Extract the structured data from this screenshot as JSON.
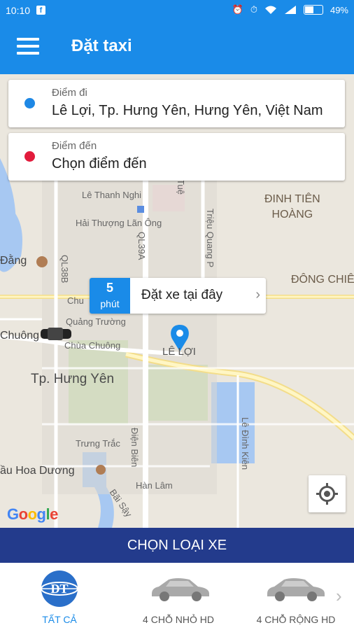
{
  "status_bar": {
    "time": "10:10",
    "fb": "f",
    "battery": "49%"
  },
  "app_bar": {
    "title": "Đặt taxi"
  },
  "origin": {
    "caption": "Điểm đi",
    "value": "Lê Lợi, Tp. Hưng Yên, Hưng Yên, Việt Nam",
    "color": "#1e88e5"
  },
  "destination": {
    "caption": "Điểm đến",
    "value": "Chọn điểm đến",
    "color": "#e21b3c"
  },
  "pickup": {
    "eta_value": "5",
    "eta_unit": "phút",
    "label": "Đặt xe tại đây"
  },
  "map": {
    "labels": {
      "le_thanh_nghi": "Lê Thanh Nghi",
      "dinh_tien_hoang": "ĐINH TIÊN\nHOÀNG",
      "hai_thuong_lan_ong": "Hải Thượng Lãn Ông",
      "dang": "Đằng",
      "ql39a": "QL39A",
      "ql38b": "QL38B",
      "dong_chieu": "ĐÔNG CHIÊ",
      "chu": "Chu",
      "quang_truong": "Quảng Trường",
      "chuong": "Chuông",
      "chua_chuong": "Chùa Chuông",
      "le_loi": "LÊ LỢI",
      "tp_hung_yen": "Tp. Hưng Yên",
      "trung_trac": "Trưng Trắc",
      "dien_bien": "Điện Biên",
      "le_dinh_kien": "Lê Đình Kiên",
      "hoa_duong": "ầu Hoa Dương",
      "bai_say": "Bãi Sậy",
      "han_lam": "Hàn Lâm",
      "trieu_quang_phuc": "Triệu Quang P",
      "tue": "Tuệ"
    },
    "attribution": "Google"
  },
  "choose_vehicle": "CHỌN LOẠI XE",
  "vehicle_tabs": [
    {
      "label": "TẤT CẢ",
      "active": true
    },
    {
      "label": "4 CHỖ NHỎ HD",
      "active": false
    },
    {
      "label": "4 CHỖ RỘNG HD",
      "active": false
    }
  ],
  "colors": {
    "primary": "#1a8be8",
    "bar_dark": "#233b8c"
  }
}
